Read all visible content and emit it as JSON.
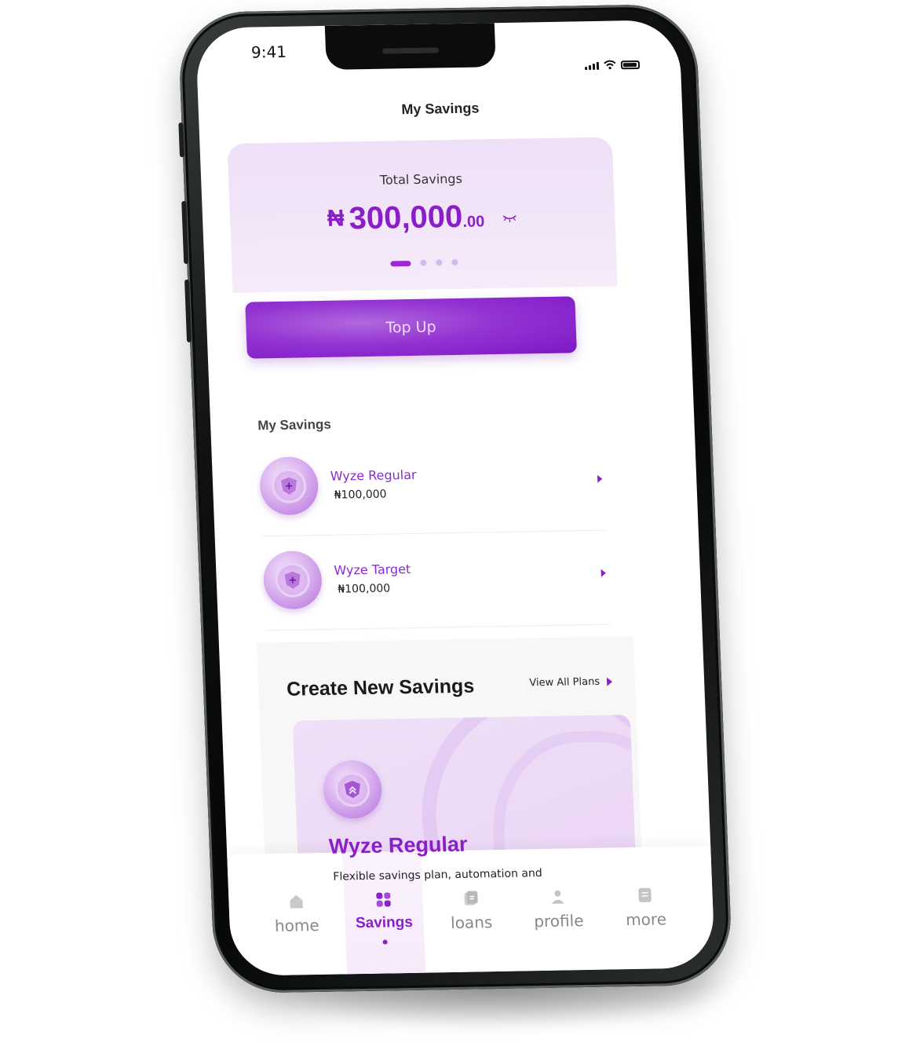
{
  "status_bar": {
    "time": "9:41"
  },
  "header": {
    "title": "My Savings"
  },
  "total_card": {
    "label": "Total Savings",
    "currency_symbol": "₦",
    "amount": "300,000",
    "decimals": ".00",
    "carousel_pages": 4,
    "active_page": 1
  },
  "topup": {
    "label": "Top Up"
  },
  "my_savings": {
    "title": "My Savings",
    "items": [
      {
        "name": "Wyze Regular",
        "amount": "₦100,000"
      },
      {
        "name": "Wyze Target",
        "amount": "₦100,000"
      }
    ]
  },
  "create": {
    "title": "Create New Savings",
    "view_all": "View All Plans",
    "plan": {
      "name": "Wyze Regular",
      "description": "Flexible savings plan, automation and"
    }
  },
  "tabs": [
    {
      "label": "home",
      "icon": "home-icon",
      "active": false
    },
    {
      "label": "Savings",
      "icon": "savings-icon",
      "active": true
    },
    {
      "label": "loans",
      "icon": "loans-icon",
      "active": false
    },
    {
      "label": "profile",
      "icon": "profile-icon",
      "active": false
    },
    {
      "label": "more",
      "icon": "more-icon",
      "active": false
    }
  ],
  "colors": {
    "accent": "#8a1fc9",
    "card_bg": "#efdff7",
    "button_bg": "#9333d2"
  }
}
